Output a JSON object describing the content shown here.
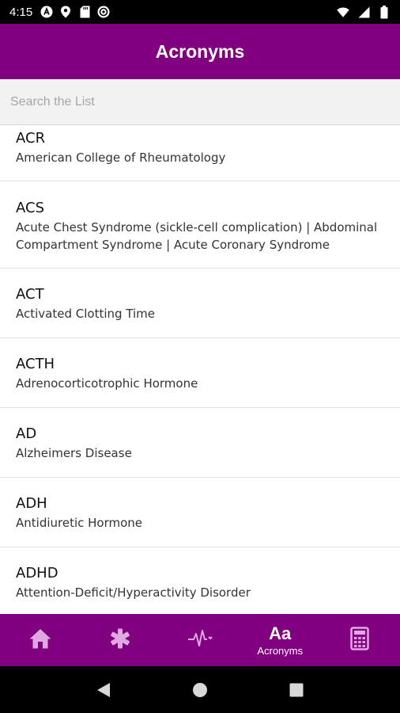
{
  "status_bar": {
    "time": "4:15",
    "icons": [
      "a-badge-icon",
      "location-icon",
      "sd-card-icon",
      "at-sign-icon",
      "wifi-icon",
      "cellular-icon",
      "battery-icon"
    ]
  },
  "header": {
    "title": "Acronyms"
  },
  "search": {
    "placeholder": "Search the List",
    "value": ""
  },
  "list": [
    {
      "acronym": "ACR",
      "meaning": "American College of Rheumatology"
    },
    {
      "acronym": "ACS",
      "meaning": "Acute Chest Syndrome (sickle-cell complication) | Abdominal Compartment Syndrome | Acute Coronary Syndrome"
    },
    {
      "acronym": "ACT",
      "meaning": "Activated Clotting Time"
    },
    {
      "acronym": "ACTH",
      "meaning": "Adrenocorticotrophic Hormone"
    },
    {
      "acronym": "AD",
      "meaning": "Alzheimers Disease"
    },
    {
      "acronym": "ADH",
      "meaning": "Antidiuretic Hormone"
    },
    {
      "acronym": "ADHD",
      "meaning": "Attention-Deficit/Hyperactivity Disorder"
    }
  ],
  "bottom_nav": {
    "items": [
      {
        "icon": "home-icon",
        "label": "",
        "active": false
      },
      {
        "icon": "medical-asterisk-icon",
        "label": "",
        "active": false
      },
      {
        "icon": "heartbeat-icon",
        "label": "",
        "active": false
      },
      {
        "icon": "acronyms-icon",
        "glyph": "Aa",
        "label": "Acronyms",
        "active": true
      },
      {
        "icon": "calculator-icon",
        "label": "",
        "active": false
      }
    ]
  },
  "colors": {
    "brand": "#800080",
    "inactive_nav": "#e0a8e0",
    "active_nav": "#ffffff"
  }
}
